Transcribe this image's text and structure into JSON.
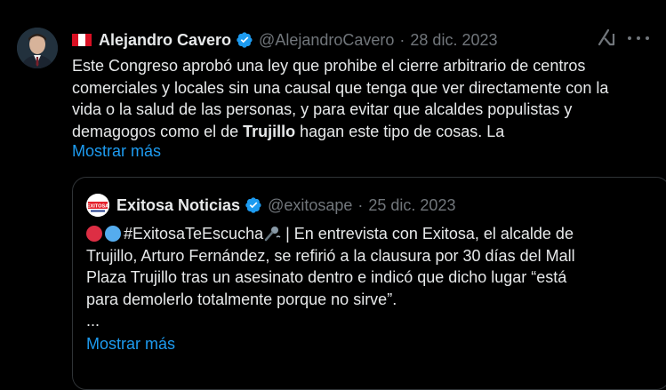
{
  "tweet": {
    "author_name": "Alejandro Cavero",
    "handle": "@AlejandroCavero",
    "date": "28 dic. 2023",
    "text_lines": [
      "Este Congreso aprobó una ley que prohibe el cierre arbitrario de centros",
      "comerciales y locales sin una causal que tenga que ver directamente con la",
      "vida o la salud de las personas, y para evitar que alcaldes populistas y"
    ],
    "line4_before": "demagogos como el de ",
    "line4_bold": "Trujillo",
    "line4_after": " hagan este tipo de cosas. La",
    "show_more": "Mostrar más"
  },
  "quote": {
    "author_name": "Exitosa Noticias",
    "handle": "@exitosape",
    "date": "25 dic. 2023",
    "hashtag": "#ExitosaTeEscucha",
    "line1_after": " | En entrevista con Exitosa, el alcalde de",
    "text_lines": [
      "Trujillo, Arturo Fernández, se refirió a la clausura por 30 días del Mall",
      "Plaza Trujillo tras un asesinato dentro e indicó que dicho lugar “está",
      "para demolerlo totalmente porque no sirve”."
    ],
    "ellipsis": "...",
    "show_more": "Mostrar más",
    "logo_text": "EXITOSA"
  },
  "icons": {
    "verified": "verified-badge-icon",
    "flag": "peru-flag-icon",
    "grok": "grok-icon",
    "more": "more-options-icon",
    "emoji_red": "red-circle-icon",
    "emoji_blue": "blue-circle-icon",
    "emoji_mic": "microphone-icon"
  },
  "colors": {
    "background": "#000000",
    "text": "#e7e9ea",
    "muted": "#71767b",
    "link": "#1d9bf0",
    "border": "#2f3336"
  }
}
